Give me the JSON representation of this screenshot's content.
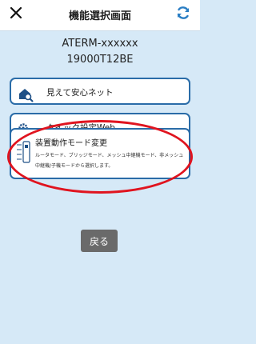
{
  "header": {
    "title": "機能選択画面",
    "close_icon": "close-icon",
    "refresh_icon": "refresh-icon"
  },
  "device": {
    "model": "ATERM-xxxxxx",
    "serial": "19000T12BE"
  },
  "menu": [
    {
      "label": "見えて安心ネット",
      "icon": "home-search-icon"
    },
    {
      "label": "クイック設定Web",
      "icon": "gear-icon"
    },
    {
      "label": "装置動作モード変更",
      "icon": "mode-switch-icon",
      "description": "ルータモード、ブリッジモード、メッシュ中継機モード、非メッシュ中継機/子機モードから選択します。"
    }
  ],
  "back_label": "戻る",
  "colors": {
    "accent": "#2a6ca8",
    "highlight": "#e0141f",
    "background": "#d6e9f7"
  }
}
